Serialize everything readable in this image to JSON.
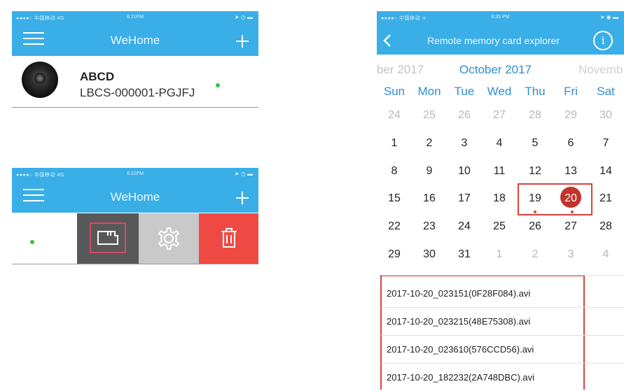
{
  "phone1": {
    "status": {
      "carrier": "●●●●○ 中国移动 4G",
      "time": "6:21PM",
      "right": "➤ ◷ ▬"
    },
    "title": "WeHome",
    "device": {
      "name": "ABCD",
      "id": "LBCS-000001-PGJFJ"
    }
  },
  "phone2": {
    "status": {
      "carrier": "●●●●○ 中国移动 4G",
      "time": "6:22PM",
      "right": "➤ ◷ ▬"
    },
    "title": "WeHome",
    "colors": {
      "sd": "#585858",
      "settings": "#c9c9c9",
      "delete": "#ee4a43"
    }
  },
  "phone3": {
    "status": {
      "carrier": "●●●●○ 中国移动 ᯤ",
      "time": "6:35 PM",
      "right": "➤ ◉ ▬"
    },
    "title": "Remote memory card explorer",
    "months": {
      "prev": "ber 2017",
      "current": "October 2017",
      "next": "Novemb"
    },
    "weekdays": [
      "Sun",
      "Mon",
      "Tue",
      "Wed",
      "Thu",
      "Fri",
      "Sat"
    ],
    "weeks": [
      [
        "24",
        "25",
        "26",
        "27",
        "28",
        "29",
        "30"
      ],
      [
        "1",
        "2",
        "3",
        "4",
        "5",
        "6",
        "7"
      ],
      [
        "8",
        "9",
        "10",
        "11",
        "12",
        "13",
        "14"
      ],
      [
        "15",
        "16",
        "17",
        "18",
        "19",
        "20",
        "21"
      ],
      [
        "22",
        "23",
        "24",
        "25",
        "26",
        "27",
        "28"
      ],
      [
        "29",
        "30",
        "31",
        "1",
        "2",
        "3",
        "4"
      ]
    ],
    "selected_day": "20",
    "files": [
      "2017-10-20_023151(0F28F084).avi",
      "2017-10-20_023215(48E75308).avi",
      "2017-10-20_023610(576CCD56).avi",
      "2017-10-20_182232(2A748DBC).avi"
    ],
    "colors": {
      "accent": "#3aaee6",
      "highlight": "#d9423a",
      "selected": "#c2332c"
    }
  }
}
